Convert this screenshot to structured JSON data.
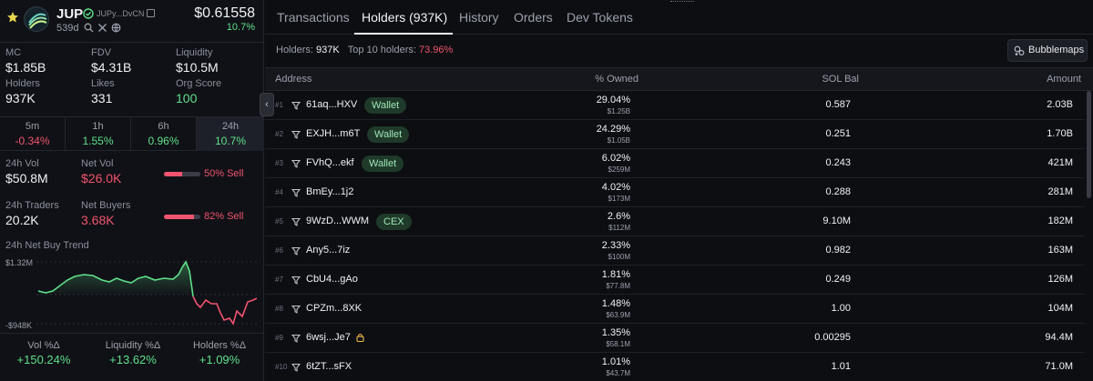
{
  "token": {
    "symbol": "JUP",
    "address": "JUPy...DvCN",
    "age": "539d",
    "price": "$0.61558",
    "change": "10.7%"
  },
  "metrics": [
    {
      "label": "MC",
      "value": "$1.85B"
    },
    {
      "label": "FDV",
      "value": "$4.31B"
    },
    {
      "label": "Liquidity",
      "value": "$10.5M"
    },
    {
      "label": "Holders",
      "value": "937K"
    },
    {
      "label": "Likes",
      "value": "331"
    },
    {
      "label": "Org Score",
      "value": "100"
    }
  ],
  "timeframes": [
    {
      "label": "5m",
      "value": "-0.34%",
      "trend": "down"
    },
    {
      "label": "1h",
      "value": "1.55%",
      "trend": "up"
    },
    {
      "label": "6h",
      "value": "0.96%",
      "trend": "up"
    },
    {
      "label": "24h",
      "value": "10.7%",
      "trend": "up",
      "active": true
    }
  ],
  "stats": {
    "vol_label": "24h Vol",
    "vol_value": "$50.8M",
    "netvol_label": "Net Vol",
    "netvol_value": "$26.0K",
    "vol_sell": "50% Sell",
    "vol_sell_pct": 50,
    "traders_label": "24h Traders",
    "traders_value": "20.2K",
    "netbuyers_label": "Net Buyers",
    "netbuyers_value": "3.68K",
    "traders_sell": "82% Sell",
    "traders_sell_pct": 82
  },
  "trend": {
    "label": "24h Net Buy Trend",
    "max_label": "$1.32M",
    "min_label": "-$948K"
  },
  "footer": [
    {
      "label": "Vol %Δ",
      "value": "+150.24%"
    },
    {
      "label": "Liquidity %Δ",
      "value": "+13.62%"
    },
    {
      "label": "Holders %Δ",
      "value": "+1.09%"
    }
  ],
  "tabs": [
    "Transactions",
    "Holders (937K)",
    "History",
    "Orders",
    "Dev Tokens"
  ],
  "holders_summary": {
    "holders_label": "Holders:",
    "holders_value": "937K",
    "top_label": "Top 10 holders:",
    "top_value": "73.96%"
  },
  "bubblemaps_label": "Bubblemaps",
  "columns": [
    "Address",
    "% Owned",
    "SOL Bal",
    "Amount"
  ],
  "holders": [
    {
      "rank": "#1",
      "address": "61aq...HXV",
      "tag": "Wallet",
      "owned": "29.04%",
      "owned_usd": "$1.25B",
      "sol": "0.587",
      "amount": "2.03B"
    },
    {
      "rank": "#2",
      "address": "EXJH...m6T",
      "tag": "Wallet",
      "owned": "24.29%",
      "owned_usd": "$1.05B",
      "sol": "0.251",
      "amount": "1.70B"
    },
    {
      "rank": "#3",
      "address": "FVhQ...ekf",
      "tag": "Wallet",
      "owned": "6.02%",
      "owned_usd": "$259M",
      "sol": "0.243",
      "amount": "421M"
    },
    {
      "rank": "#4",
      "address": "BmEy...1j2",
      "tag": "",
      "owned": "4.02%",
      "owned_usd": "$173M",
      "sol": "0.288",
      "amount": "281M"
    },
    {
      "rank": "#5",
      "address": "9WzD...WWM",
      "tag": "CEX",
      "owned": "2.6%",
      "owned_usd": "$112M",
      "sol": "9.10M",
      "amount": "182M"
    },
    {
      "rank": "#6",
      "address": "Any5...7iz",
      "tag": "",
      "owned": "2.33%",
      "owned_usd": "$100M",
      "sol": "0.982",
      "amount": "163M"
    },
    {
      "rank": "#7",
      "address": "CbU4...gAo",
      "tag": "",
      "owned": "1.81%",
      "owned_usd": "$77.8M",
      "sol": "0.249",
      "amount": "126M"
    },
    {
      "rank": "#8",
      "address": "CPZm...8XK",
      "tag": "",
      "owned": "1.48%",
      "owned_usd": "$63.9M",
      "sol": "1.00",
      "amount": "104M"
    },
    {
      "rank": "#9",
      "address": "6wsj...Je7",
      "tag": "",
      "lock": true,
      "owned": "1.35%",
      "owned_usd": "$58.1M",
      "sol": "0.00295",
      "amount": "94.4M"
    },
    {
      "rank": "#10",
      "address": "6tZT...sFX",
      "tag": "",
      "owned": "1.01%",
      "owned_usd": "$43.7M",
      "sol": "1.01",
      "amount": "71.0M"
    }
  ],
  "colors": {
    "green": "#5ee08a",
    "red": "#f0546e",
    "badge_bg": "#1f3a2a"
  }
}
